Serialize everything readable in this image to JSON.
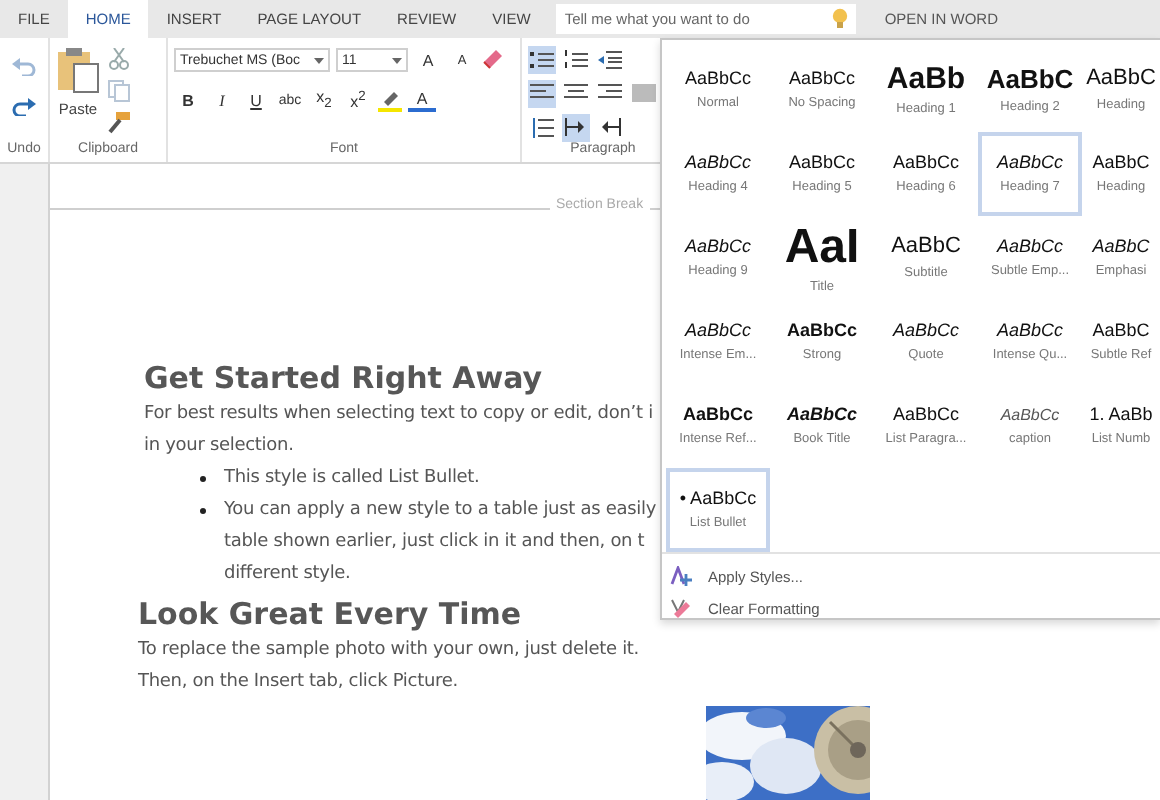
{
  "menu_tabs": [
    {
      "label": "FILE",
      "selected": false
    },
    {
      "label": "HOME",
      "selected": true
    },
    {
      "label": "INSERT",
      "selected": false
    },
    {
      "label": "PAGE LAYOUT",
      "selected": false
    },
    {
      "label": "REVIEW",
      "selected": false
    },
    {
      "label": "VIEW",
      "selected": false
    }
  ],
  "tell_me": {
    "placeholder": "Tell me what you want to do"
  },
  "open_in_word": "OPEN IN WORD",
  "ribbon": {
    "groups": [
      "Undo",
      "Clipboard",
      "Font",
      "Paragraph"
    ],
    "paste": "Paste",
    "font_name": "Trebuchet MS (Boc",
    "font_size": "11",
    "grow_shrink": [
      "A",
      "A"
    ],
    "format_buttons": [
      "B",
      "I",
      "U",
      "abc",
      "x$_{2}$",
      "x$^{2}$"
    ],
    "font_color": "A",
    "paragraph_buttons": [
      {
        "selected": true
      },
      {
        "selected": false
      },
      {
        "selected": false
      },
      {
        "selected": true
      },
      {
        "selected": false
      },
      {
        "selected": false
      },
      {
        "selected": false
      },
      {
        "selected": false
      },
      {
        "selected": true
      },
      {
        "selected": false
      }
    ]
  },
  "document": {
    "section_break": "Section Break",
    "sections": [
      {
        "heading": "Get Started Right Away",
        "paragraph": [
          "For best results when selecting text to copy or edit, don’t i",
          "in your selection."
        ],
        "bullets": [
          [
            "This style is called List Bullet."
          ],
          [
            "You can apply a new style to a table just as easily",
            "table shown earlier, just click in it and then, on t",
            "different style."
          ]
        ]
      },
      {
        "heading": "Look Great Every Time",
        "paragraph": [
          "To replace the sample photo with your own, just delete it.",
          "Then, on the Insert tab, click Picture."
        ]
      }
    ]
  },
  "styles_gallery": {
    "styles": [
      {
        "preview": "AaBbCc",
        "name": "Normal",
        "kind": "normal",
        "selected": false
      },
      {
        "preview": "AaBbCc",
        "name": "No Spacing",
        "kind": "normal",
        "selected": false
      },
      {
        "preview": "AaBb",
        "name": "Heading 1",
        "kind": "h1",
        "selected": false
      },
      {
        "preview": "AaBbC",
        "name": "Heading 2",
        "kind": "h2",
        "selected": false
      },
      {
        "preview": "AaBbC",
        "name": "Heading",
        "kind": "h3",
        "selected": false
      },
      {
        "preview": "AaBbCc",
        "name": "Heading 4",
        "kind": "italic",
        "selected": false
      },
      {
        "preview": "AaBbCc",
        "name": "Heading 5",
        "kind": "normal",
        "selected": false
      },
      {
        "preview": "AaBbCc",
        "name": "Heading 6",
        "kind": "normal",
        "selected": false
      },
      {
        "preview": "AaBbCc",
        "name": "Heading 7",
        "kind": "italic",
        "selected": true
      },
      {
        "preview": "AaBbC",
        "name": "Heading",
        "kind": "normal",
        "selected": false
      },
      {
        "preview": "AaBbCc",
        "name": "Heading 9",
        "kind": "italic",
        "selected": false
      },
      {
        "preview": "AaI",
        "name": "Title",
        "kind": "title",
        "selected": false
      },
      {
        "preview": "AaBbC",
        "name": "Subtitle",
        "kind": "subtitle",
        "selected": false
      },
      {
        "preview": "AaBbCc",
        "name": "Subtle Emp...",
        "kind": "italic",
        "selected": false
      },
      {
        "preview": "AaBbC",
        "name": "Emphasi",
        "kind": "italic",
        "selected": false
      },
      {
        "preview": "AaBbCc",
        "name": "Intense Em...",
        "kind": "italic",
        "selected": false
      },
      {
        "preview": "AaBbCc",
        "name": "Strong",
        "kind": "bold",
        "selected": false
      },
      {
        "preview": "AaBbCc",
        "name": "Quote",
        "kind": "italic",
        "selected": false
      },
      {
        "preview": "AaBbCc",
        "name": "Intense Qu...",
        "kind": "italic",
        "selected": false
      },
      {
        "preview": "AaBbC",
        "name": "Subtle Ref",
        "kind": "normal",
        "selected": false
      },
      {
        "preview": "AaBbCc",
        "name": "Intense Ref...",
        "kind": "bold",
        "selected": false
      },
      {
        "preview": "AaBbCc",
        "name": "Book Title",
        "kind": "bolditalic",
        "selected": false
      },
      {
        "preview": "AaBbCc",
        "name": "List Paragra...",
        "kind": "normal",
        "selected": false
      },
      {
        "preview": "AaBbCc",
        "name": "caption",
        "kind": "caption",
        "selected": false
      },
      {
        "preview": "1. AaBb",
        "name": "List Numb",
        "kind": "normal",
        "selected": false
      },
      {
        "preview": "• AaBbCc",
        "name": "List Bullet",
        "kind": "normal",
        "selected": true
      }
    ],
    "actions": [
      "Apply Styles...",
      "Clear Formatting"
    ]
  }
}
